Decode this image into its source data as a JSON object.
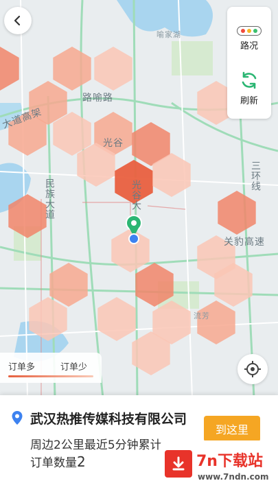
{
  "map": {
    "labels": {
      "lake": "喻家湖",
      "luoyu_road": "路喻路",
      "dadao_gaojia": "大道高架",
      "guanggu": "光谷",
      "minzu_dadao": "民族大道",
      "guanggu_road": "光谷大",
      "sanhuan": "三环线",
      "guanbao_gaosu": "关豹高速",
      "liufang": "流芳"
    },
    "heat_colors": [
      "#e9603f",
      "#f1856a",
      "#f7a88f",
      "#fac6b5"
    ]
  },
  "controls": {
    "back_icon": "chevron-left-icon",
    "traffic_label": "路况",
    "refresh_label": "刷新",
    "traffic_colors": [
      "#f04b3c",
      "#f5b623",
      "#3cbf6e"
    ],
    "refresh_color": "#2bb673"
  },
  "legend": {
    "more_label": "订单多",
    "less_label": "订单少"
  },
  "card": {
    "place_name": "武汉热推传媒科技有限公司",
    "line1": "周边2公里最近5分钟累计",
    "line2_prefix": "订单数量",
    "line2_count": "2",
    "go_button": "到这里",
    "accent": "#f5a623"
  },
  "watermark": {
    "title": "7n下载站",
    "subtitle": "www.7ndn.com"
  }
}
